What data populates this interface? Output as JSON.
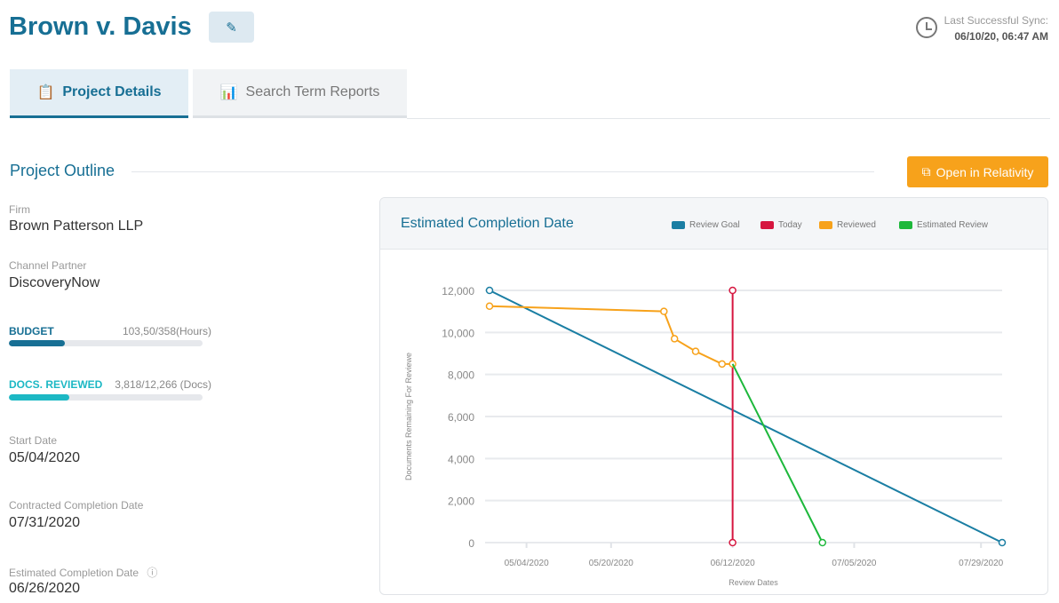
{
  "header": {
    "title": "Brown v. Davis",
    "edit_icon": "pencil-icon",
    "sync_label": "Last Successful Sync:",
    "sync_value": "06/10/20, 06:47 AM"
  },
  "tabs": [
    {
      "label": "Project Details",
      "icon": "clipboard-icon",
      "active": true
    },
    {
      "label": "Search Term Reports",
      "icon": "bar-chart-icon",
      "active": false
    }
  ],
  "outline": {
    "title": "Project Outline",
    "open_button": "Open in Relativity",
    "firm_label": "Firm",
    "firm": "Brown Patterson LLP",
    "partner_label": "Channel Partner",
    "partner": "DiscoveryNow",
    "budget_label": "BUDGET",
    "budget_value": "103,50/358(Hours)",
    "budget_fraction": 0.289,
    "docs_label": "DOCS. REVIEWED",
    "docs_value": "3,818/12,266 (Docs)",
    "docs_fraction": 0.311,
    "start_label": "Start Date",
    "start": "05/04/2020",
    "contracted_label": "Contracted Completion Date",
    "contracted": "07/31/2020",
    "estimated_label": "Estimated Completion Date",
    "estimated": "06/26/2020"
  },
  "colors": {
    "primary": "#176f94",
    "budget": "#176f94",
    "docs": "#1cb8c4",
    "orange": "#f7a21b"
  },
  "chart_data": {
    "type": "line",
    "title": "Estimated Completion Date",
    "xlabel": "Review Dates",
    "ylabel": "Documents Remaining For Reviewe",
    "ylim": [
      0,
      12000
    ],
    "yticks": [
      0,
      2000,
      4000,
      6000,
      8000,
      10000,
      12000
    ],
    "ytick_labels": [
      "0",
      "2,000",
      "4,000",
      "6,000",
      "8,000",
      "10,000",
      "12,000"
    ],
    "xlim": [
      "2020-04-27",
      "2020-08-02"
    ],
    "xticks": [
      "2020-05-04",
      "2020-05-20",
      "2020-06-12",
      "2020-07-05",
      "2020-07-29"
    ],
    "xtick_labels": [
      "05/04/2020",
      "05/20/2020",
      "06/12/2020",
      "07/05/2020",
      "07/29/2020"
    ],
    "grid": true,
    "legend": "top-right",
    "series": [
      {
        "name": "Review Goal",
        "color": "#1a7ea3",
        "points": [
          [
            "2020-04-27",
            12000
          ],
          [
            "2020-08-02",
            0
          ]
        ]
      },
      {
        "name": "Today",
        "color": "#d6163f",
        "points": [
          [
            "2020-06-12",
            12000
          ],
          [
            "2020-06-12",
            0
          ]
        ]
      },
      {
        "name": "Reviewed",
        "color": "#f7a21b",
        "points": [
          [
            "2020-04-27",
            11250
          ],
          [
            "2020-05-30",
            11000
          ],
          [
            "2020-06-01",
            9700
          ],
          [
            "2020-06-05",
            9100
          ],
          [
            "2020-06-10",
            8500
          ],
          [
            "2020-06-12",
            8500
          ]
        ]
      },
      {
        "name": "Estimated Review",
        "color": "#1db83b",
        "points": [
          [
            "2020-06-12",
            8500
          ],
          [
            "2020-06-29",
            0
          ]
        ]
      }
    ]
  }
}
